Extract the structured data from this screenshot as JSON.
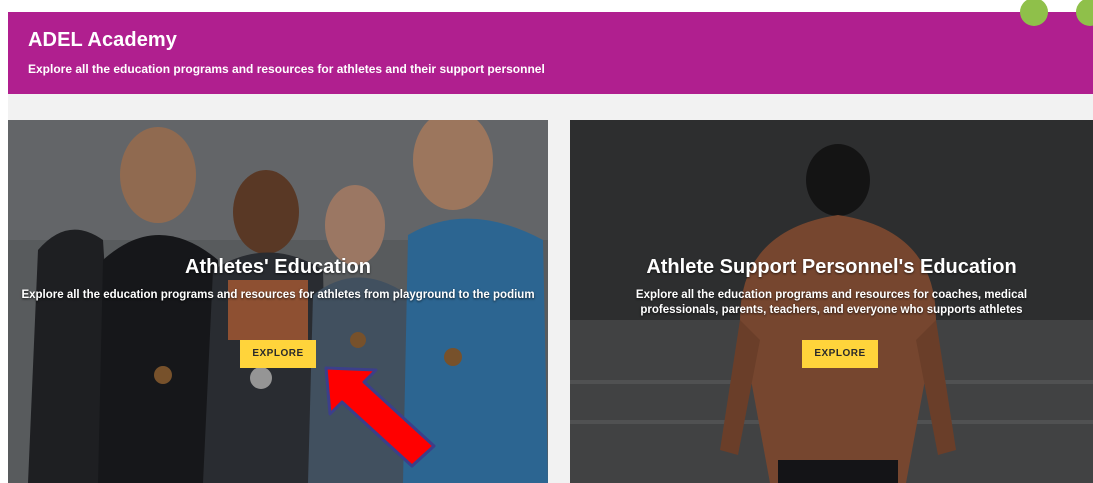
{
  "header": {
    "title": "ADEL Academy",
    "subtitle": "Explore all the education programs and resources for athletes and their support personnel",
    "color": "#b01f8f"
  },
  "cards": [
    {
      "title": "Athletes' Education",
      "description": "Explore all the education programs and resources for athletes from playground to the podium",
      "button_label": "EXPLORE"
    },
    {
      "title": "Athlete Support Personnel's Education",
      "description": "Explore all the education programs and resources for coaches, medical professionals, parents, teachers, and everyone who supports athletes",
      "button_label": "EXPLORE"
    }
  ],
  "annotation": {
    "arrow_color": "#ff0000",
    "points_to": "athletes-explore-button"
  },
  "colors": {
    "button": "#ffd43b",
    "page_background": "#f2f2f2"
  }
}
